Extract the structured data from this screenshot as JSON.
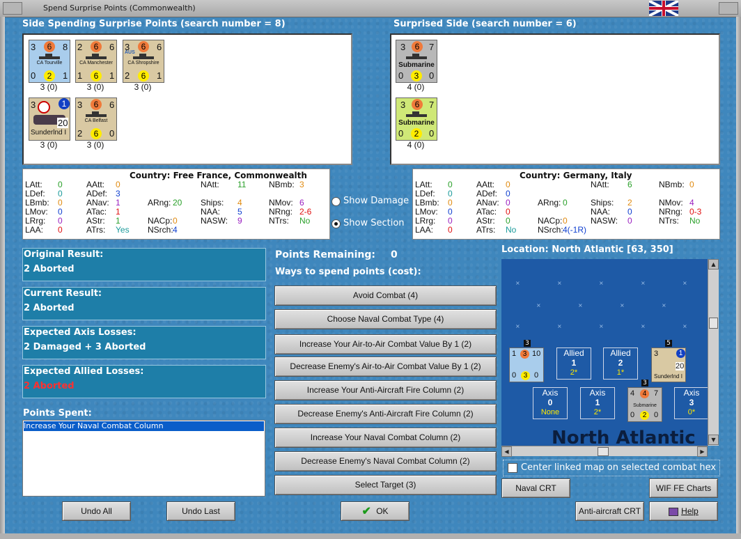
{
  "window": {
    "title": "Spend Surprise Points (Commonwealth)"
  },
  "spending": {
    "header": "Side Spending Surprise Points (search number = 8)",
    "counters": [
      {
        "top_left": "3",
        "top_mid": "6",
        "top_right": "8",
        "name": "CA Tourville",
        "bl": "0",
        "bm": "2",
        "br": "1",
        "below": "3 (0)",
        "bg": "#a9cdec"
      },
      {
        "top_left": "2",
        "top_mid": "6",
        "top_right": "6",
        "name": "CA Manchester",
        "bl": "1",
        "bm": "6",
        "br": "1",
        "below": "3 (0)",
        "bg": "#d9c9a3"
      },
      {
        "top_left": "3",
        "top_mid": "6",
        "top_right": "6",
        "name": "CA Shropshire",
        "bl": "2",
        "bm": "6",
        "br": "1",
        "below": "3 (0)",
        "bg": "#d9c9a3",
        "tag": "AUS"
      },
      {
        "top_left": "3",
        "top_mid": "",
        "top_right": "1",
        "name": "Sunderlnd I",
        "bl": "1",
        "bm": "",
        "br": "20",
        "below": "3 (0)",
        "bg": "#d9c9a3"
      },
      {
        "top_left": "3",
        "top_mid": "6",
        "top_right": "6",
        "name": "CA Belfast",
        "bl": "2",
        "bm": "6",
        "br": "0",
        "below": "3 (0)",
        "bg": "#d9c9a3"
      }
    ]
  },
  "surprised": {
    "header": "Surprised Side (search number = 6)",
    "counters": [
      {
        "top_left": "3",
        "top_mid": "6",
        "top_right": "7",
        "name": "Submarine",
        "bl": "0",
        "bm": "3",
        "br": "0",
        "below": "4 (0)",
        "bg": "#b8b8b8"
      },
      {
        "top_left": "3",
        "top_mid": "6",
        "top_right": "7",
        "name": "Submarine",
        "bl": "0",
        "bm": "2",
        "br": "0",
        "below": "4 (0)",
        "bg": "#cfe877"
      }
    ]
  },
  "stats_left": {
    "country_label": "Country: Free France, Commonwealth",
    "rows": [
      [
        "LAtt:",
        "0",
        "AAtt:",
        "0",
        "",
        "",
        "NAtt:",
        "11",
        "NBmb:",
        "3"
      ],
      [
        "LDef:",
        "0",
        "ADef:",
        "3",
        "",
        "",
        "",
        "",
        "",
        ""
      ],
      [
        "LBmb:",
        "0",
        "ANav:",
        "1",
        "ARng:",
        "20",
        "Ships:",
        "4",
        "NMov:",
        "6"
      ],
      [
        "LMov:",
        "0",
        "ATac:",
        "1",
        "",
        "",
        "NAA:",
        "5",
        "NRng:",
        "2-6"
      ],
      [
        "LRrg:",
        "0",
        "AStr:",
        "1",
        "NACp:",
        "0",
        "NASW:",
        "9",
        "NTrs:",
        "No"
      ],
      [
        "LAA:",
        "0",
        "ATrs:",
        "Yes",
        "NSrch:",
        "4",
        "",
        "",
        "",
        ""
      ]
    ]
  },
  "stats_right": {
    "country_label": "Country: Germany, Italy",
    "rows": [
      [
        "LAtt:",
        "0",
        "AAtt:",
        "0",
        "",
        "",
        "NAtt:",
        "6",
        "NBmb:",
        "0"
      ],
      [
        "LDef:",
        "0",
        "ADef:",
        "0",
        "",
        "",
        "",
        "",
        "",
        ""
      ],
      [
        "LBmb:",
        "0",
        "ANav:",
        "0",
        "ARng:",
        "0",
        "Ships:",
        "2",
        "NMov:",
        "4"
      ],
      [
        "LMov:",
        "0",
        "ATac:",
        "0",
        "",
        "",
        "NAA:",
        "0",
        "NRng:",
        "0-3"
      ],
      [
        "LRrg:",
        "0",
        "AStr:",
        "0",
        "NACp:",
        "0",
        "NASW:",
        "0",
        "NTrs:",
        "No"
      ],
      [
        "LAA:",
        "0",
        "ATrs:",
        "No",
        "NSrch:",
        "4(-1R)",
        "",
        "",
        "",
        ""
      ]
    ]
  },
  "options": {
    "show_damage": "Show Damage",
    "show_section": "Show Section"
  },
  "results": {
    "original_title": "Original Result:",
    "original_value": "2 Aborted",
    "current_title": "Current Result:",
    "current_value": "2 Aborted",
    "axis_title": "Expected Axis Losses:",
    "axis_value": "2 Damaged + 3 Aborted",
    "allied_title": "Expected Allied Losses:",
    "allied_value": "2 Aborted"
  },
  "points_spent": {
    "label": "Points Spent:",
    "items": [
      "Increase Your Naval Combat Column"
    ]
  },
  "points_remaining": {
    "label": "Points Remaining:",
    "value": "0"
  },
  "ways_label": "Ways to spend points (cost):",
  "spend_options": [
    "Avoid Combat (4)",
    "Choose Naval Combat Type (4)",
    "Increase Your Air-to-Air Combat Value By 1 (2)",
    "Decrease Enemy's Air-to-Air Combat Value By 1 (2)",
    "Increase Your Anti-Aircraft Fire Column (2)",
    "Decrease Enemy's Anti-Aircraft Fire Column (2)",
    "Increase Your Naval Combat Column (2)",
    "Decrease Enemy's Naval Combat Column (2)",
    "Select Target (3)"
  ],
  "location": {
    "label": "Location: North Atlantic [63, 350]",
    "big": "North Atlantic"
  },
  "map_boxes": {
    "allied": [
      {
        "a": "Allied",
        "b": "1",
        "c": "2*"
      },
      {
        "a": "Allied",
        "b": "2",
        "c": "1*"
      }
    ],
    "axis": [
      {
        "a": "Axis",
        "b": "0",
        "c": "None"
      },
      {
        "a": "Axis",
        "b": "1",
        "c": "2*"
      },
      {
        "a": "Axis",
        "b": "3",
        "c": "0*"
      }
    ],
    "stack1": {
      "tl": "1",
      "tm": "3",
      "tr": "10",
      "bl": "0",
      "bm": "3",
      "br": "0",
      "count": "3"
    },
    "stack2": {
      "tl": "3",
      "tr": "1",
      "bl": "1",
      "br": "20",
      "name": "Sunderlnd I",
      "count": "5"
    },
    "stack3": {
      "tl": "4",
      "tm": "4",
      "tr": "7",
      "name": "Submarine",
      "bl": "0",
      "bm": "2",
      "br": "0",
      "count": "3"
    }
  },
  "center_map_label": "Center linked map on selected combat hex",
  "buttons": {
    "naval_crt": "Naval CRT",
    "wif_charts": "WIF FE Charts",
    "aa_crt": "Anti-aircraft CRT",
    "help": "Help",
    "undo_all": "Undo All",
    "undo_last": "Undo Last",
    "ok": "OK"
  },
  "colors": {
    "accent": "#3f87bd",
    "result_box": "#1e7ea8",
    "red": "#ff3030"
  }
}
